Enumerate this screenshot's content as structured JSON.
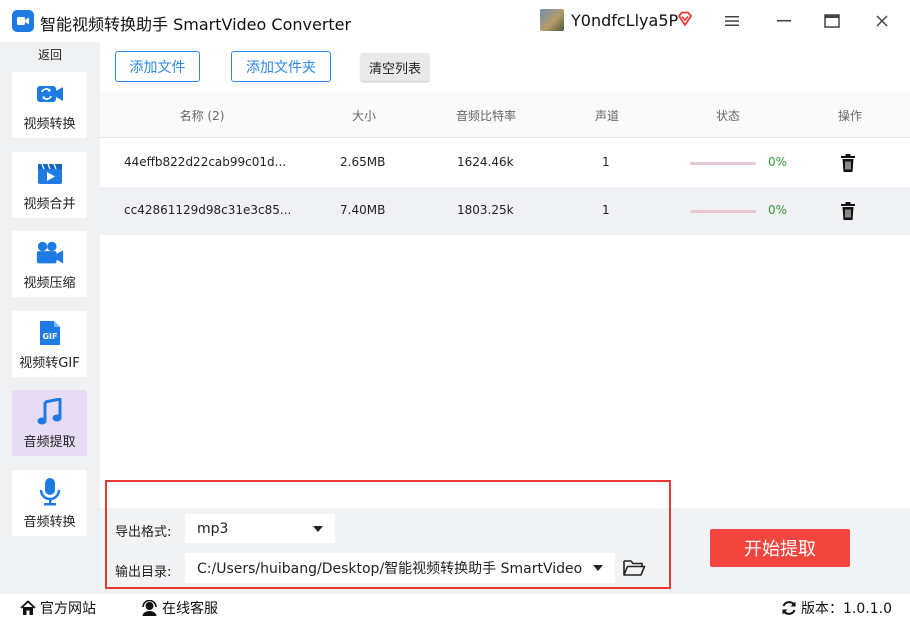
{
  "window": {
    "title": "智能视频转换助手 SmartVideo Converter",
    "username": "Y0ndfcLlya5P",
    "minimize_icon": "menu-icon",
    "accent": "#2b8be6"
  },
  "sidebar": {
    "back_label": "返回",
    "items": [
      {
        "label": "视频转换",
        "icon": "video-convert-icon"
      },
      {
        "label": "视频合并",
        "icon": "video-merge-icon"
      },
      {
        "label": "视频压缩",
        "icon": "video-compress-icon"
      },
      {
        "label": "视频转GIF",
        "icon": "gif-icon"
      },
      {
        "label": "音频提取",
        "icon": "music-note-icon",
        "active": true
      },
      {
        "label": "音频转换",
        "icon": "microphone-icon"
      }
    ]
  },
  "toolbar": {
    "add_file": "添加文件",
    "add_folder": "添加文件夹",
    "clear_list": "清空列表"
  },
  "table": {
    "headers": [
      "名称 (2)",
      "大小",
      "音频比特率",
      "声道",
      "状态",
      "操作"
    ],
    "rows": [
      {
        "name": "44effb822d22cab99c01d...",
        "size": "2.65MB",
        "bitrate": "1624.46k",
        "channels": "1",
        "progress": 0,
        "status": "0%"
      },
      {
        "name": "cc42861129d98c31e3c85...",
        "size": "7.40MB",
        "bitrate": "1803.25k",
        "channels": "1",
        "progress": 0,
        "status": "0%"
      }
    ]
  },
  "output": {
    "format_label": "导出格式:",
    "format_value": "mp3",
    "dir_label": "输出目录:",
    "dir_value": "C:/Users/huibang/Desktop/智能视频转换助手 SmartVideo",
    "start_button": "开始提取"
  },
  "footer": {
    "website": "官方网站",
    "support": "在线客服",
    "version": "版本：1.0.1.0"
  },
  "colors": {
    "start_button": "#f2453d",
    "highlight_border": "#e53935",
    "progress_track": "#e8c8d0",
    "status_text": "#3a9a3a"
  }
}
